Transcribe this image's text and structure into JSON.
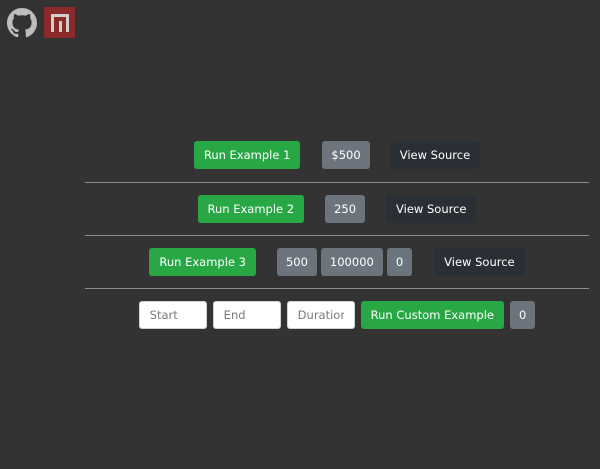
{
  "corner_links": {
    "github": {
      "icon": "github-icon"
    },
    "npm": {
      "icon": "npm-icon",
      "color": "#8a2a2a"
    }
  },
  "colors": {
    "background": "#333333",
    "green": "#28a745",
    "gray_badge": "#6c757d",
    "dark_button": "#2a2e35"
  },
  "example1": {
    "run_label": "Run Example 1",
    "value": "$500",
    "source_label": "View Source"
  },
  "example2": {
    "run_label": "Run Example 2",
    "value": "250",
    "source_label": "View Source"
  },
  "example3": {
    "run_label": "Run Example 3",
    "start": "500",
    "end": "100000",
    "value": "0",
    "source_label": "View Source"
  },
  "custom": {
    "start_placeholder": "Start",
    "end_placeholder": "End",
    "duration_placeholder": "Duration",
    "run_label": "Run Custom Example",
    "value": "0"
  }
}
